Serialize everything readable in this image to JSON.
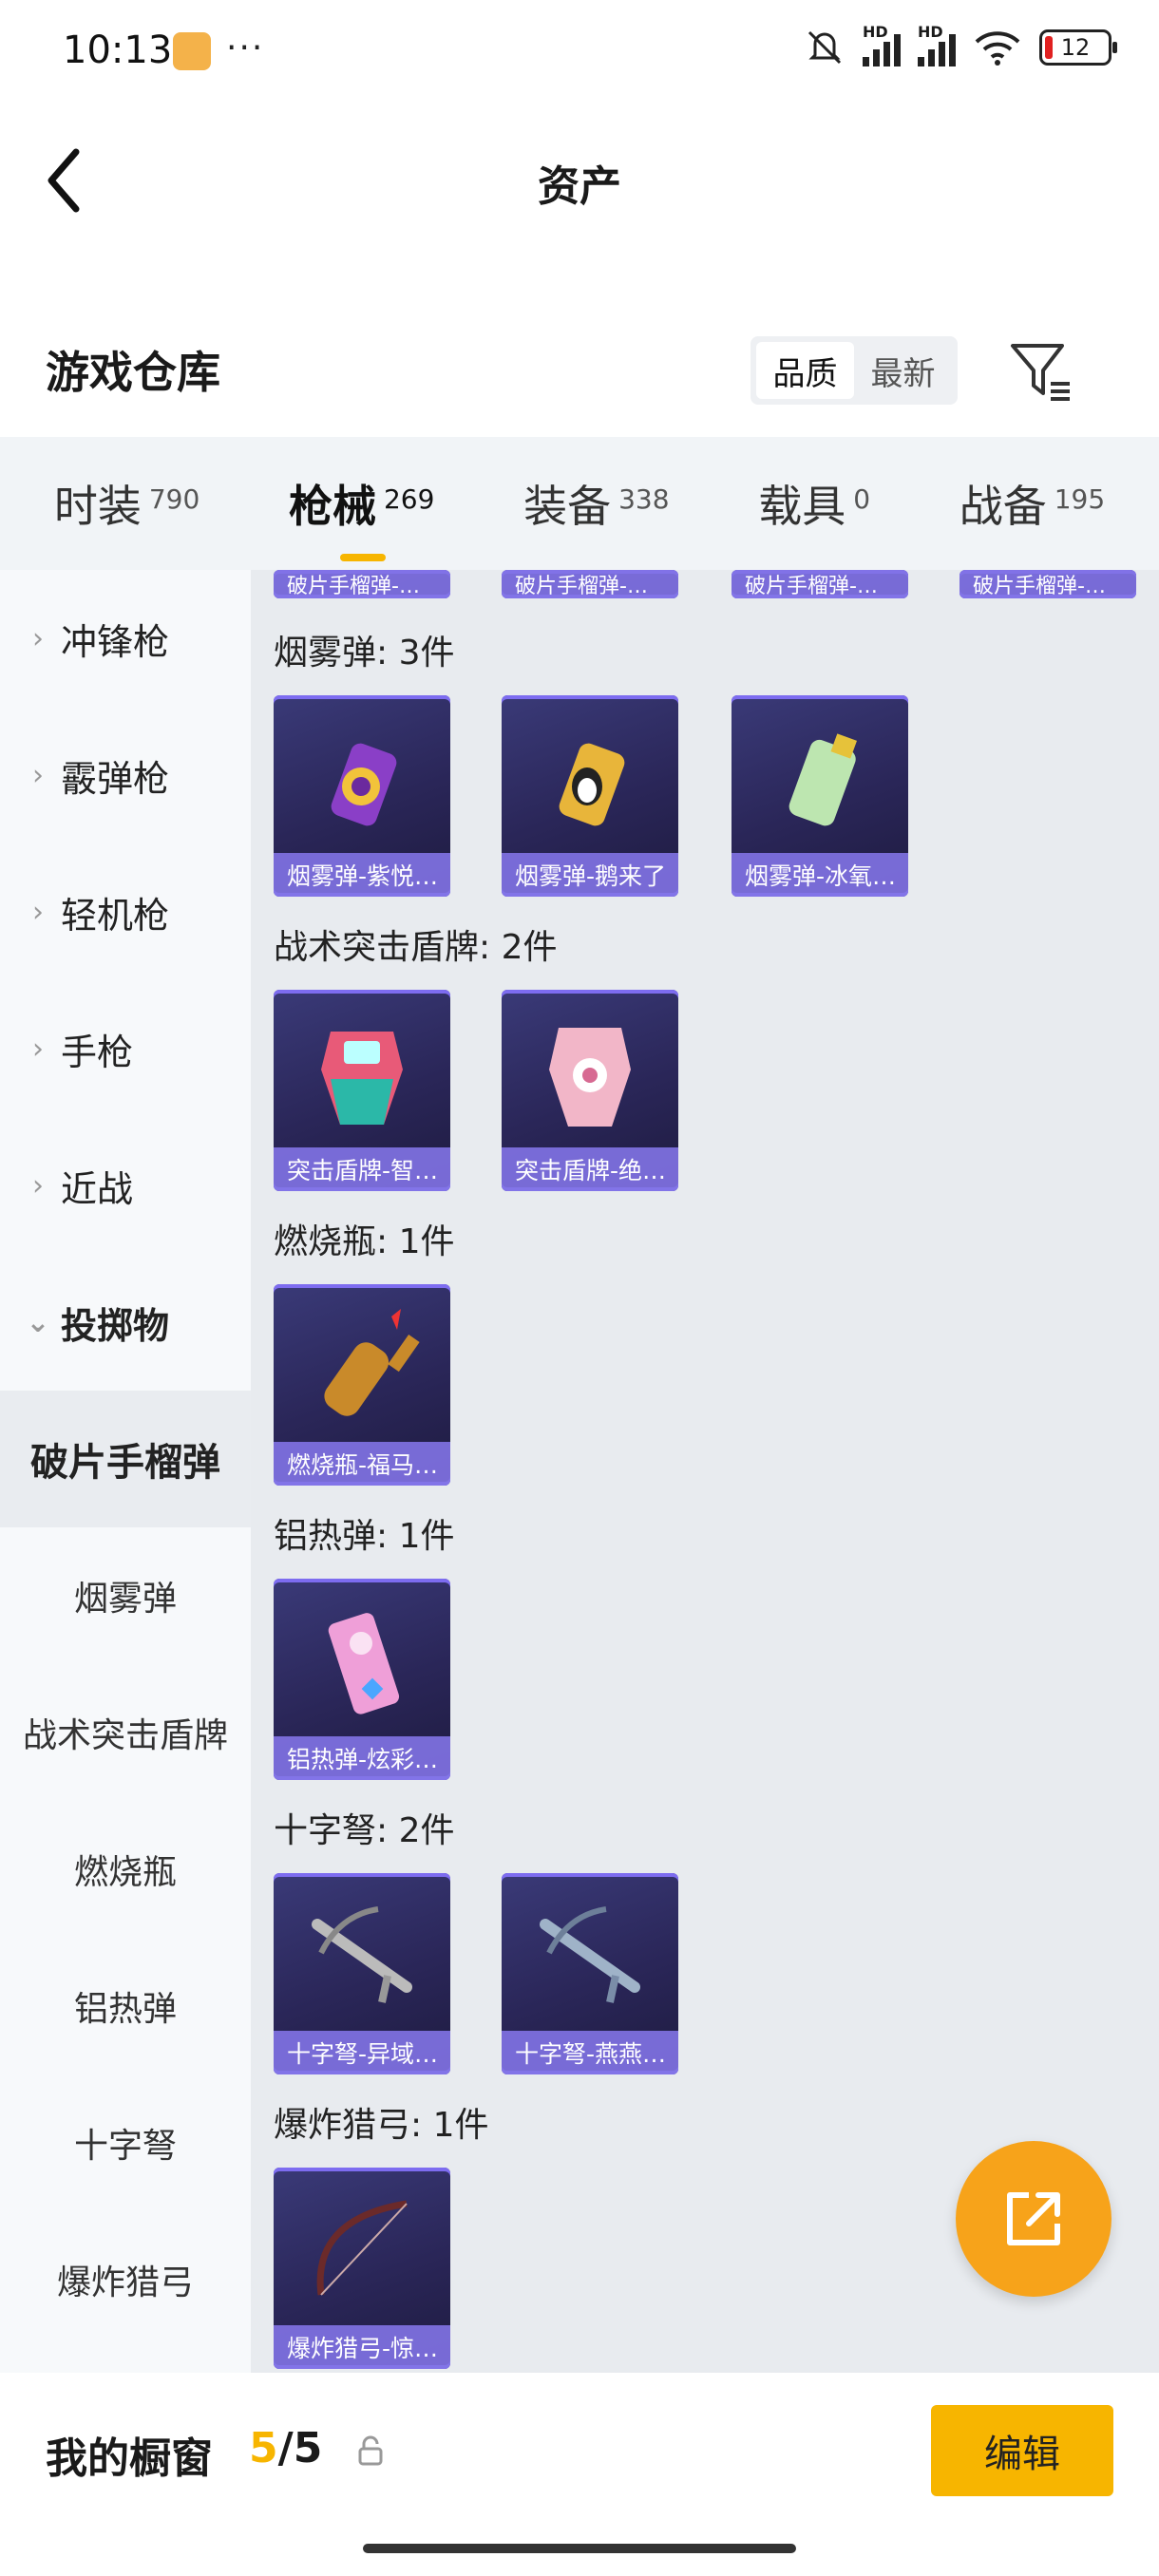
{
  "status": {
    "time": "10:13",
    "dots": "···",
    "battery": "12",
    "hd1": "HD",
    "hd2": "HD"
  },
  "header": {
    "title": "资产"
  },
  "warehouse": {
    "title": "游戏仓库",
    "sort": [
      "品质",
      "最新"
    ],
    "sort_active": "品质"
  },
  "tabs": [
    {
      "label": "时装",
      "count": "790"
    },
    {
      "label": "枪械",
      "count": "269",
      "active": true
    },
    {
      "label": "装备",
      "count": "338"
    },
    {
      "label": "载具",
      "count": "0"
    },
    {
      "label": "战备",
      "count": "195"
    }
  ],
  "sidebar": {
    "categories": [
      "冲锋枪",
      "霰弹枪",
      "轻机枪",
      "手枪",
      "近战"
    ],
    "open_category": "投掷物",
    "selected": "破片手榴弹",
    "subs": [
      "烟雾弹",
      "战术突击盾牌",
      "燃烧瓶",
      "铝热弹",
      "十字弩",
      "爆炸猎弓"
    ]
  },
  "content": {
    "top_stubs": [
      "破片手榴弹-…",
      "破片手榴弹-…",
      "破片手榴弹-…",
      "破片手榴弹-…"
    ],
    "sections": [
      {
        "title": "烟雾弹: 3件",
        "items": [
          "烟雾弹-紫悦…",
          "烟雾弹-鹅来了",
          "烟雾弹-冰氧…"
        ]
      },
      {
        "title": "战术突击盾牌: 2件",
        "items": [
          "突击盾牌-智…",
          "突击盾牌-绝…"
        ]
      },
      {
        "title": "燃烧瓶: 1件",
        "items": [
          "燃烧瓶-福马…"
        ]
      },
      {
        "title": "铝热弹: 1件",
        "items": [
          "铝热弹-炫彩…"
        ]
      },
      {
        "title": "十字弩: 2件",
        "items": [
          "十字弩-异域…",
          "十字弩-燕燕…"
        ]
      },
      {
        "title": "爆炸猎弓: 1件",
        "items": [
          "爆炸猎弓-惊…"
        ]
      }
    ]
  },
  "bottom": {
    "label": "我的橱窗",
    "current": "5",
    "total": "/5",
    "edit": "编辑"
  },
  "colors": {
    "accent": "#f7b500",
    "fab": "#f7a31a",
    "card_bg": "#2a2658",
    "card_caption": "#8273e6"
  }
}
